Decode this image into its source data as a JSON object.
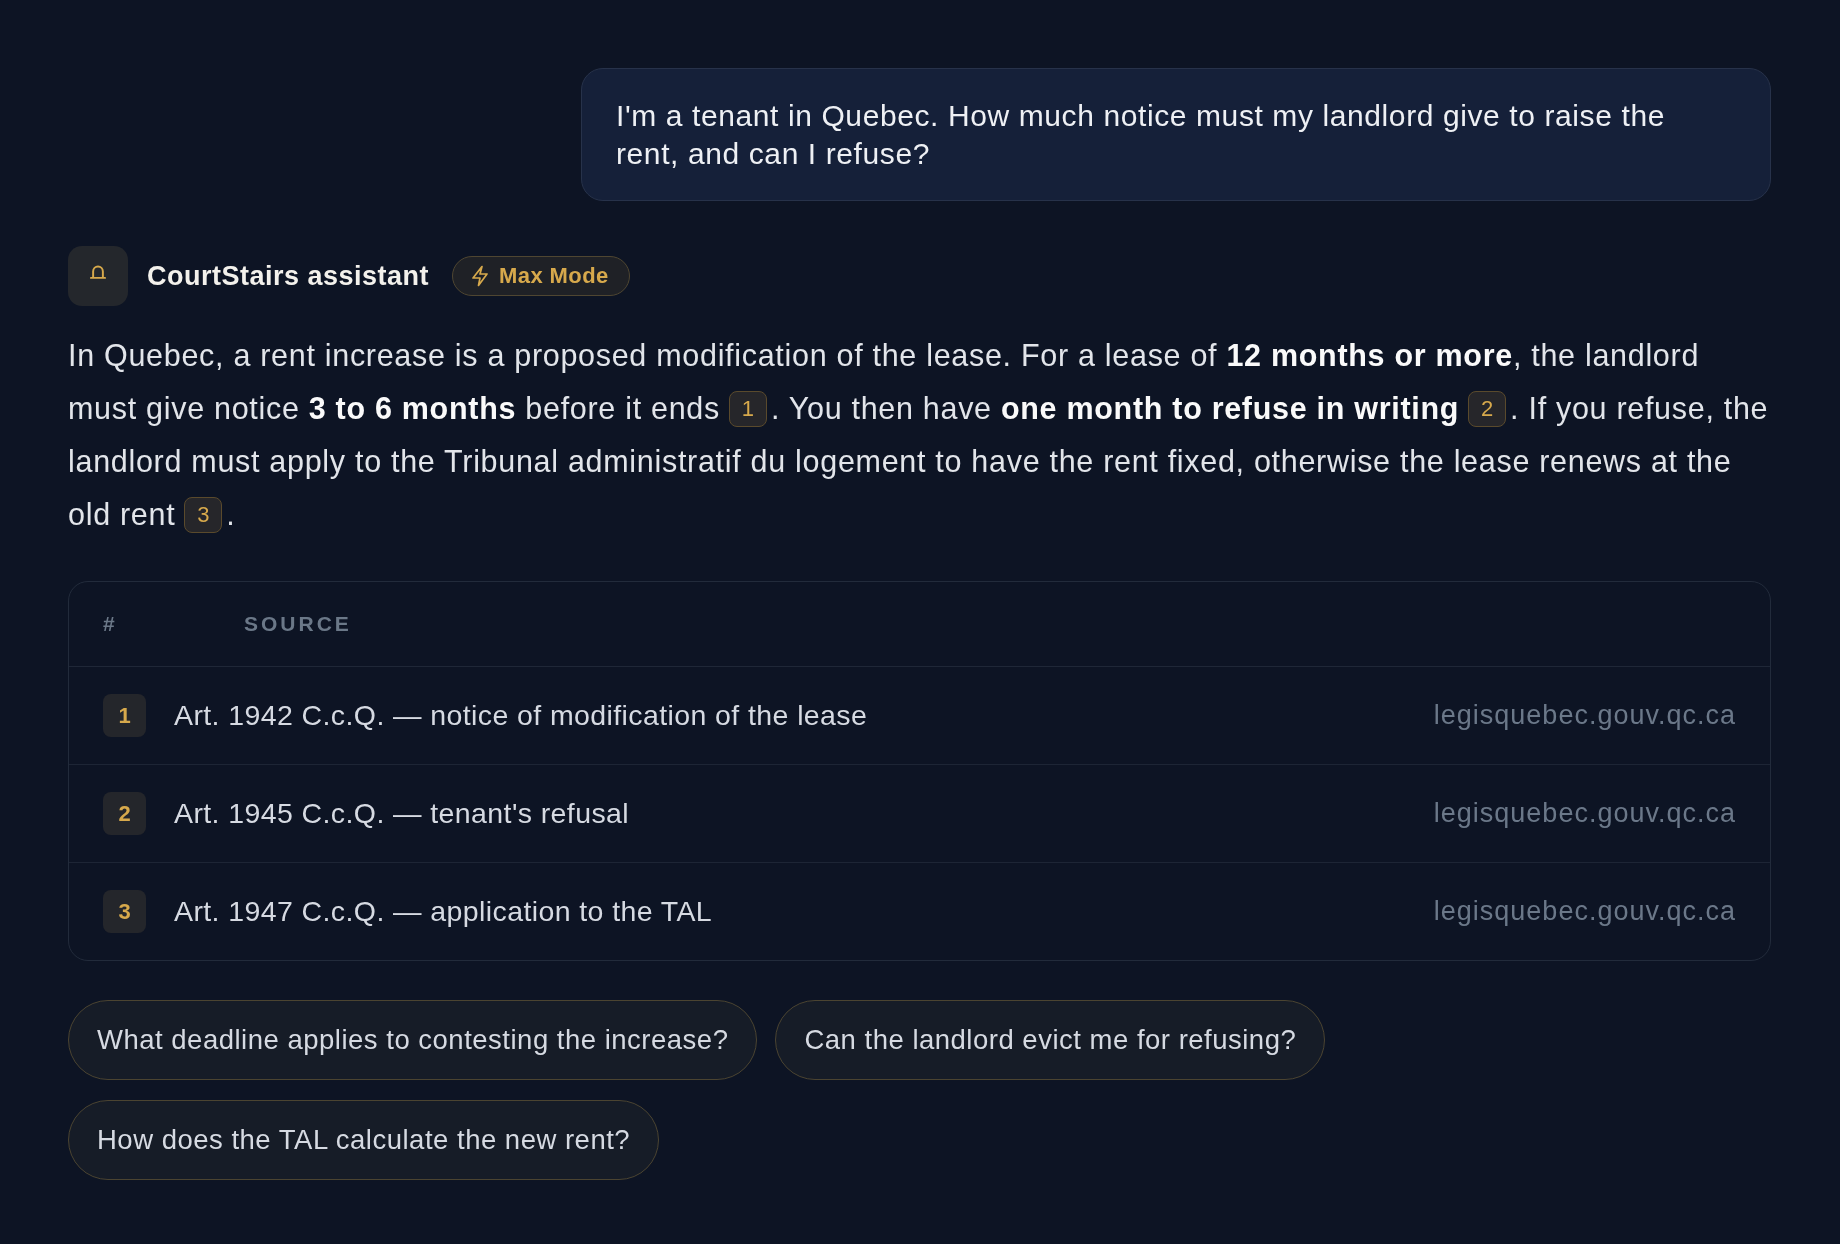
{
  "user_message": {
    "text": "I'm a tenant in Quebec. How much notice must my landlord give to raise the rent, and can I refuse?"
  },
  "assistant": {
    "name": "CourtStairs assistant",
    "mode_badge": {
      "label": "Max Mode"
    },
    "answer": [
      {
        "kind": "text",
        "text": "In Quebec, a rent increase is a proposed modification of the lease. For a lease of **12 months or more**, the landlord must give notice **3 to 6 months** before it ends"
      },
      {
        "kind": "citation",
        "label": "1"
      },
      {
        "kind": "text",
        "text": ". You then have **one month to refuse in writing**"
      },
      {
        "kind": "citation",
        "label": "2"
      },
      {
        "kind": "text",
        "text": ". If you refuse, the landlord must apply to the Tribunal administratif du logement to have the rent fixed, otherwise the lease renews at the old rent"
      },
      {
        "kind": "citation",
        "label": "3"
      },
      {
        "kind": "text",
        "text": "."
      }
    ]
  },
  "sources": {
    "columns": [
      "#",
      "SOURCE"
    ],
    "rows": [
      {
        "number": "1",
        "title": "Art. 1942 C.c.Q. — notice of modification of the lease",
        "domain": "legisquebec.gouv.qc.ca"
      },
      {
        "number": "2",
        "title": "Art. 1945 C.c.Q. — tenant's refusal",
        "domain": "legisquebec.gouv.qc.ca"
      },
      {
        "number": "3",
        "title": "Art. 1947 C.c.Q. — application to the TAL",
        "domain": "legisquebec.gouv.qc.ca"
      }
    ]
  },
  "suggestions": [
    {
      "text": "What deadline applies to contesting the increase?"
    },
    {
      "text": "Can the landlord evict me for refusing?"
    },
    {
      "text": "How does the TAL calculate the new rent?"
    }
  ]
}
